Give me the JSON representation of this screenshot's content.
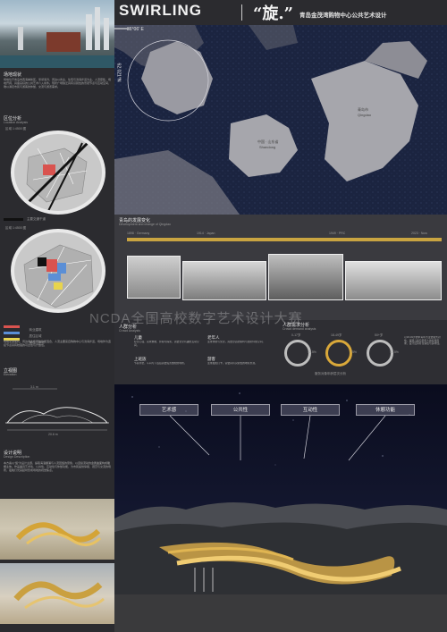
{
  "header": {
    "title_en": "SWIRLING",
    "title_cn": "“旋.”",
    "subtitle": "青岛金茂湾购物中心公共艺术设计"
  },
  "left": {
    "site_title": "场地现状",
    "site_text": "场地位于青岛市西海岸新区，紧邻海湾，周边以商业、住宅与滨海步道为主，人流密集，场地开阔，具备良好的公共艺术介入条件。现状广场缺乏具有识别性的景观节点与互动空间，难以满足市民与游客的休憩、交流与游览需求。",
    "location_title": "区位分析",
    "location_sub": "Location Analysis",
    "map1_caption": "区域 1:4500 图",
    "map1_legend": "主要交通干道",
    "map2_caption": "区域 1:4500 图",
    "legend": [
      {
        "label": "商业建筑",
        "color": "#d9534f"
      },
      {
        "label": "居住区域",
        "color": "#5b8fd6"
      },
      {
        "label": "景观 · 绿地",
        "color": "#e8d44d"
      }
    ],
    "analysis_text": "场地交通便利，周边商业与居住功能混合，人流主要来自购物中心与滨海步道，场地作为连接节点具有较强的可达性与开放性。",
    "elevation_title": "立视图",
    "elevation_sub": "Elevation",
    "elev_dim_top": "3.1 m",
    "elev_dim_bottom": "20.6 m",
    "design_title": "设计说明",
    "design_sub": "Design Description",
    "design_text": "本方案以“旋”为设计主题，提取海浪翻涌与人流回旋的意象，以连续流动的金属曲面构成雕塑主体。作品兼具艺术性、公共性、互动性与休憩功能，为市民提供停留、观赏与交流的场所，夜晚灯光亮起时形成场地的视觉焦点。"
  },
  "map": {
    "coord_top": "36°06′ E",
    "coord_side": "62.021°N",
    "label_shandong_cn": "中国 · 山东省",
    "label_shandong_en": "Shandong",
    "label_qingdao_cn": "青岛市",
    "label_qingdao_en": "Qingdao"
  },
  "timeline": {
    "title": "青岛的发展变化",
    "subtitle": "Development and change of Qingdao",
    "dates": [
      "1898 · Germany",
      "1914 · Japan",
      "1949 · PRC",
      "2023 · Now"
    ]
  },
  "people": {
    "title": "人群分析",
    "subtitle": "Crowd Analysis",
    "groups": [
      {
        "name": "儿童",
        "text": "好奇心强，喜欢攀爬、奔跑与探索，需要安全有趣的互动空间。"
      },
      {
        "name": "老年人",
        "text": "注重休憩与交流，需要舒适的座椅与遮阴停留空间。"
      },
      {
        "name": "上班族",
        "text": "节奏紧张，午间与下班后需要短暂放松的场所。"
      },
      {
        "name": "游客",
        "text": "注重拍照打卡，需要具有识别性的地标景观。"
      }
    ],
    "demand_title": "人群需求分析",
    "demand_sub": "Crowd demand analysis",
    "rings": [
      {
        "label": "0-17岁",
        "pct": "12.5%"
      },
      {
        "label": "18-49岁",
        "pct": "75%"
      },
      {
        "label": "50+岁",
        "pct": "12.5%"
      }
    ],
    "demand_caption": "服务对象年龄层次分析",
    "demand_text": "以18-49岁的中青年为主要服务对象，兼顾儿童与老年人的使用需求，设计应具有包容性与多样性。"
  },
  "night": {
    "labels": [
      "艺术感",
      "公共性",
      "互动性",
      "休憩功能"
    ]
  },
  "watermark": "NCDA全国高校数字艺术设计大赛"
}
